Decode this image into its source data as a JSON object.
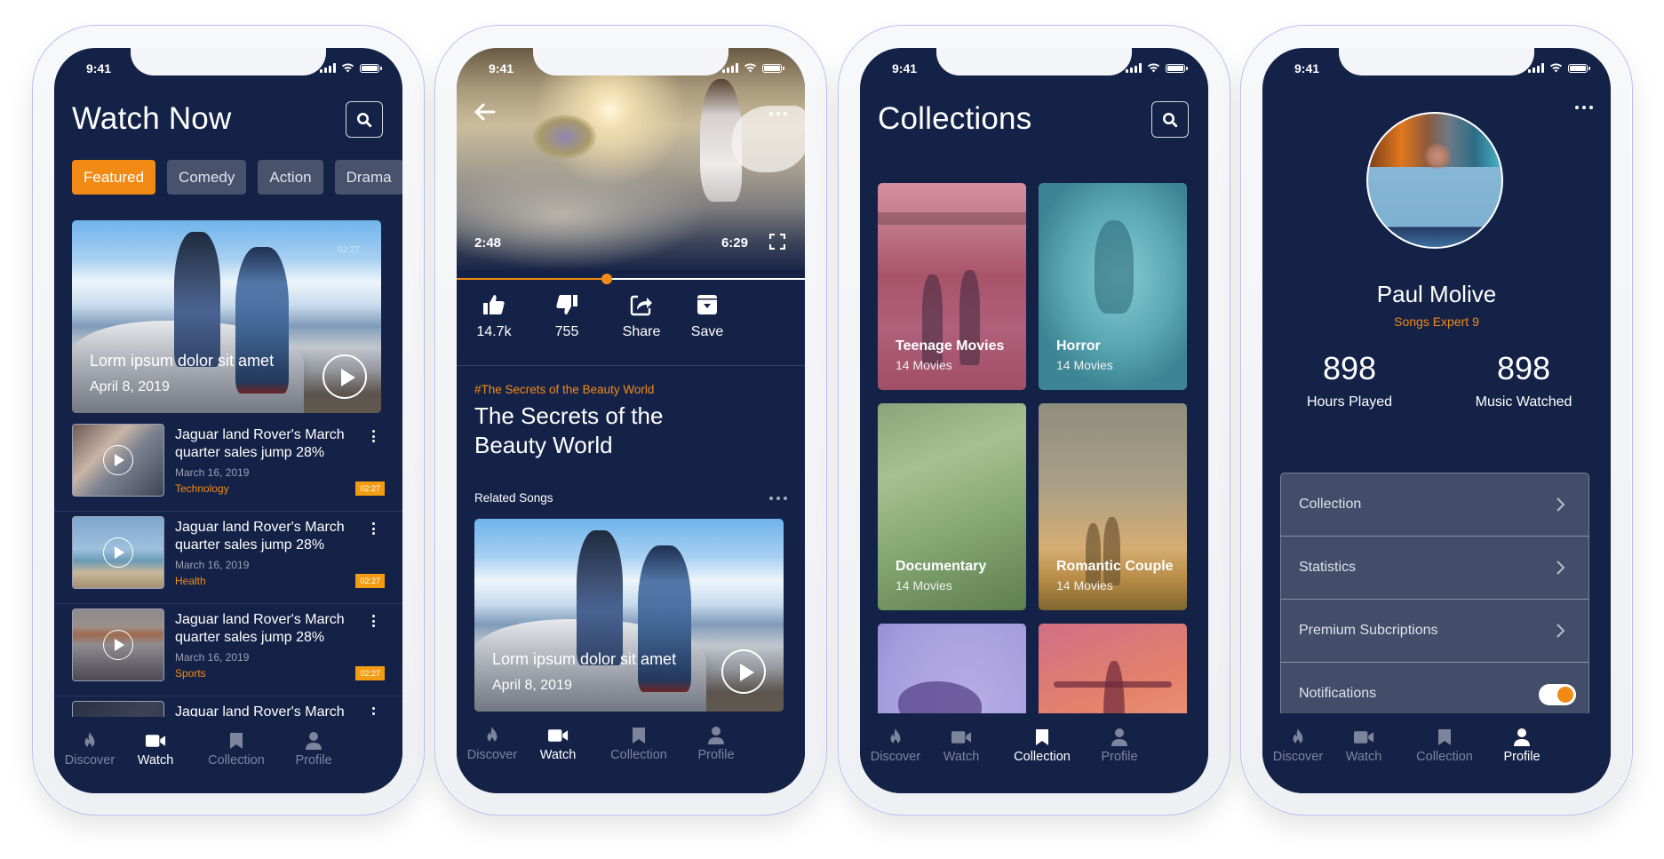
{
  "status_bar": {
    "time": "9:41"
  },
  "colors": {
    "background": "#152248",
    "accent": "#f28b16",
    "chip": "#48526d",
    "inactive_nav": "#7d849c"
  },
  "nav_labels": [
    "Discover",
    "Watch",
    "Collection",
    "Profile"
  ],
  "nav_icons": [
    "flame-icon",
    "video-camera-icon",
    "bookmark-icon",
    "user-icon"
  ],
  "watch_now": {
    "title": "Watch Now",
    "chips": [
      "Featured",
      "Comedy",
      "Action",
      "Drama"
    ],
    "active_chip": "Featured",
    "hero": {
      "title": "Lorm ipsum dolor sit amet",
      "date": "April 8, 2019",
      "duration": "02:27"
    },
    "items": [
      {
        "title": "Jaguar land Rover's March quarter sales jump 28%",
        "date": "March 16, 2019",
        "category": "Technology",
        "duration": "02:27"
      },
      {
        "title": "Jaguar land Rover's March quarter sales jump 28%",
        "date": "March 16, 2019",
        "category": "Health",
        "duration": "02:27"
      },
      {
        "title": "Jaguar land Rover's March quarter sales jump 28%",
        "date": "March 16, 2019",
        "category": "Sports",
        "duration": "02:27"
      },
      {
        "title": "Jaguar land Rover's March",
        "date": "",
        "category": "",
        "duration": ""
      }
    ],
    "active_nav": "Watch"
  },
  "player": {
    "current_time": "2:48",
    "total_time": "6:29",
    "progress_fraction": 0.43,
    "actions": [
      {
        "icon": "thumbs-up-icon",
        "label": "14.7k"
      },
      {
        "icon": "thumbs-down-icon",
        "label": "755"
      },
      {
        "icon": "share-icon",
        "label": "Share"
      },
      {
        "icon": "save-icon",
        "label": "Save"
      }
    ],
    "tagline": "#The Secrets of the Beauty World",
    "title": "The Secrets of the Beauty World",
    "related_label": "Related Songs",
    "related": {
      "title": "Lorm ipsum dolor sit amet",
      "date": "April 8, 2019"
    },
    "active_nav": "Watch"
  },
  "collections": {
    "title": "Collections",
    "cards": [
      {
        "title": "Teenage Movies",
        "count": "14 Movies"
      },
      {
        "title": "Horror",
        "count": "14 Movies"
      },
      {
        "title": "Documentary",
        "count": "14 Movies"
      },
      {
        "title": "Romantic Couple",
        "count": "14 Movies"
      },
      {
        "title": "",
        "count": ""
      },
      {
        "title": "",
        "count": ""
      }
    ],
    "active_nav": "Collection"
  },
  "profile": {
    "name": "Paul Molive",
    "level": "Songs Expert 9",
    "stats": [
      {
        "value": "898",
        "label": "Hours Played"
      },
      {
        "value": "898",
        "label": "Music Watched"
      }
    ],
    "settings": [
      {
        "label": "Collection",
        "type": "link"
      },
      {
        "label": "Statistics",
        "type": "link"
      },
      {
        "label": "Premium Subcriptions",
        "type": "link"
      },
      {
        "label": "Notifications",
        "type": "toggle",
        "value": true
      }
    ],
    "active_nav": "Profile"
  }
}
